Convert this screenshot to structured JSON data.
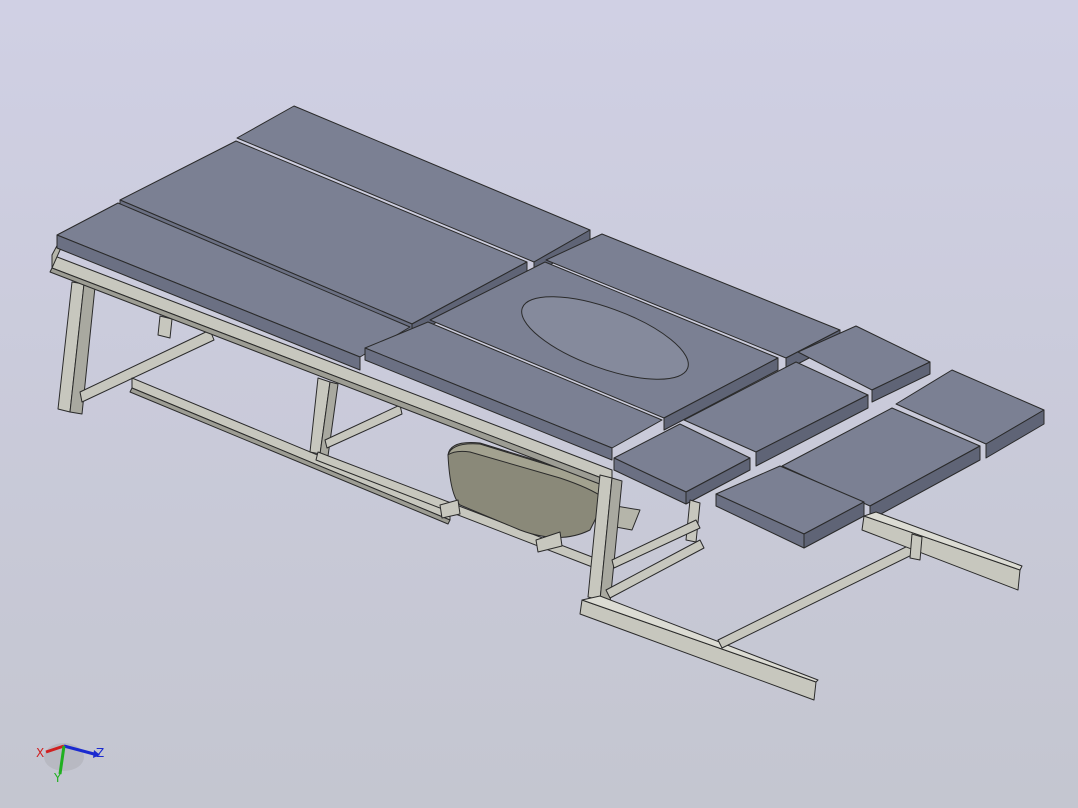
{
  "viewport": {
    "background_top": "#d0d0e4",
    "background_bottom": "#c4c6d0",
    "model": {
      "pad_color": "#7b8093",
      "pad_side_color": "#5f6476",
      "frame_color": "#c7c7be",
      "frame_shadow": "#9d9d94",
      "tub_color": "#8a8979",
      "edge_color": "#2a2a2a"
    }
  },
  "triad": {
    "x_label": "X",
    "y_label": "Y",
    "z_label": "Z",
    "x_color": "#d02020",
    "y_color": "#20b020",
    "z_color": "#1a2ad0"
  }
}
